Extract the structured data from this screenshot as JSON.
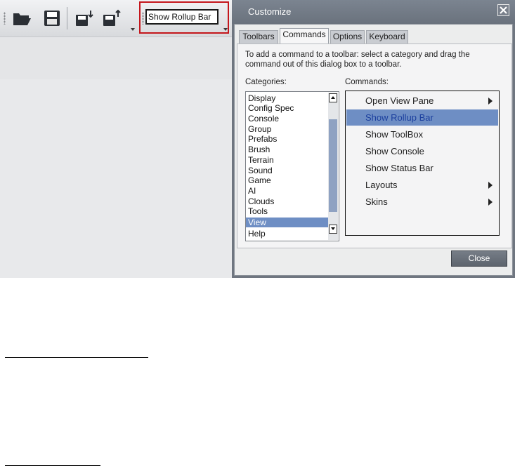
{
  "toolbar": {
    "rollup_button_label": "Show Rollup Bar",
    "icons": [
      "open-folder-icon",
      "save-icon",
      "import-icon",
      "export-icon"
    ]
  },
  "dialog": {
    "title": "Customize",
    "tabs": [
      {
        "label": "Toolbars",
        "active": false
      },
      {
        "label": "Commands",
        "active": true
      },
      {
        "label": "Options",
        "active": false
      },
      {
        "label": "Keyboard",
        "active": false
      }
    ],
    "instructions": "To add a command to a toolbar: select a category and drag the command out of this dialog box to a toolbar.",
    "categories_label": "Categories:",
    "commands_label": "Commands:",
    "categories": [
      "Display",
      "Config Spec",
      "Console",
      "Group",
      "Prefabs",
      "Brush",
      "Terrain",
      "Sound",
      "Game",
      "AI",
      "Clouds",
      "Tools",
      "View",
      "Help"
    ],
    "selected_category": "View",
    "commands": [
      {
        "label": "Open View Pane",
        "submenu": true,
        "selected": false
      },
      {
        "label": "Show Rollup Bar",
        "submenu": false,
        "selected": true
      },
      {
        "label": "Show ToolBox",
        "submenu": false,
        "selected": false
      },
      {
        "label": "Show Console",
        "submenu": false,
        "selected": false
      },
      {
        "label": "Show Status Bar",
        "submenu": false,
        "selected": false
      },
      {
        "label": "Layouts",
        "submenu": true,
        "selected": false
      },
      {
        "label": "Skins",
        "submenu": true,
        "selected": false
      }
    ],
    "close_label": "Close"
  },
  "colors": {
    "selection": "#6e8ec4",
    "selected_command_text": "#1b3f9e",
    "highlight_box": "#c4161c",
    "dialog_frame": "#6f7680"
  }
}
